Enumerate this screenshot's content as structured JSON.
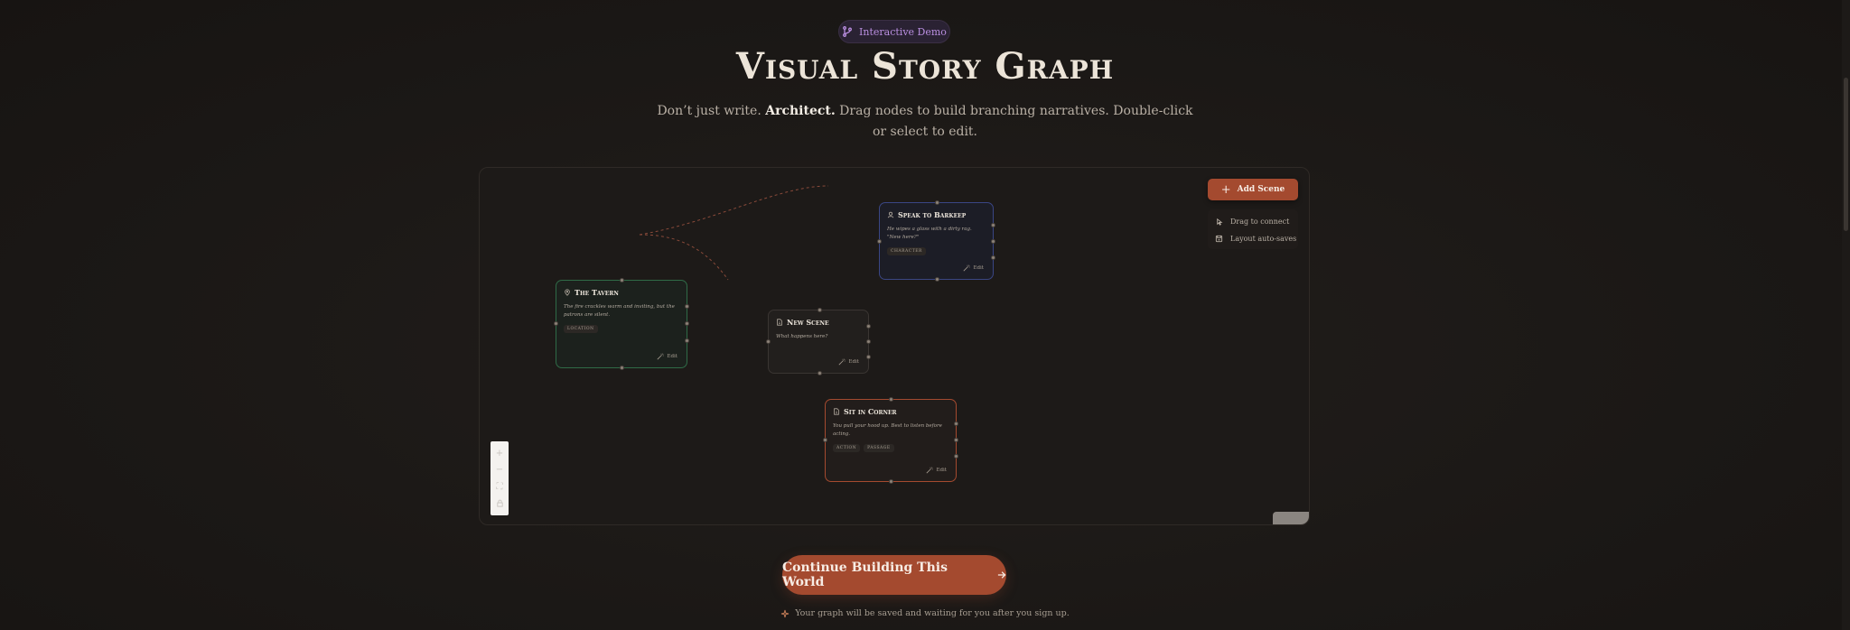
{
  "badge": {
    "label": "Interactive Demo",
    "icon": "branch-icon",
    "color": "#b98ee0"
  },
  "header": {
    "title": "Visual Story Graph",
    "subtitle_pre": "Don’t just write. ",
    "subtitle_bold": "Architect.",
    "subtitle_post": " Drag nodes to build branching narratives. Double-click or select to edit."
  },
  "toolbar": {
    "add_scene_label": "Add Scene",
    "hints": [
      {
        "icon": "pointer-icon",
        "label": "Drag to connect"
      },
      {
        "icon": "save-icon",
        "label": "Layout auto-saves"
      }
    ]
  },
  "nodes": [
    {
      "id": "tavern",
      "icon": "map-pin-icon",
      "title": "The Tavern",
      "description": "The fire crackles warm and inviting, but the patrons are silent.",
      "tags": [
        "Location"
      ],
      "edit_label": "Edit",
      "border": "#2f6b47"
    },
    {
      "id": "barkeep",
      "icon": "user-icon",
      "title": "Speak to Barkeep",
      "description": "He wipes a glass with a dirty rag. \"New here?\"",
      "tags": [
        "Character"
      ],
      "edit_label": "Edit",
      "border": "#3a4684"
    },
    {
      "id": "new-scene",
      "icon": "document-icon",
      "title": "New Scene",
      "description": "What happens here?",
      "tags": [],
      "edit_label": "Edit",
      "border": "#3a3532"
    },
    {
      "id": "corner",
      "icon": "document-icon",
      "title": "Sit in Corner",
      "description": "You pull your hood up. Best to listen before acting.",
      "tags": [
        "Action",
        "Passage"
      ],
      "edit_label": "Edit",
      "border": "#a44a2f"
    }
  ],
  "controls": [
    "zoom-in-icon",
    "zoom-out-icon",
    "fit-view-icon",
    "lock-icon"
  ],
  "cta": {
    "label": "Continue Building This World",
    "icon": "arrow-right-icon"
  },
  "footnote": {
    "icon": "sparkle-icon",
    "label": "Your graph will be saved and waiting for you after you sign up."
  },
  "colors": {
    "accent": "#a44a2f",
    "background": "#1b1816",
    "edge": "#8a4a3a"
  }
}
